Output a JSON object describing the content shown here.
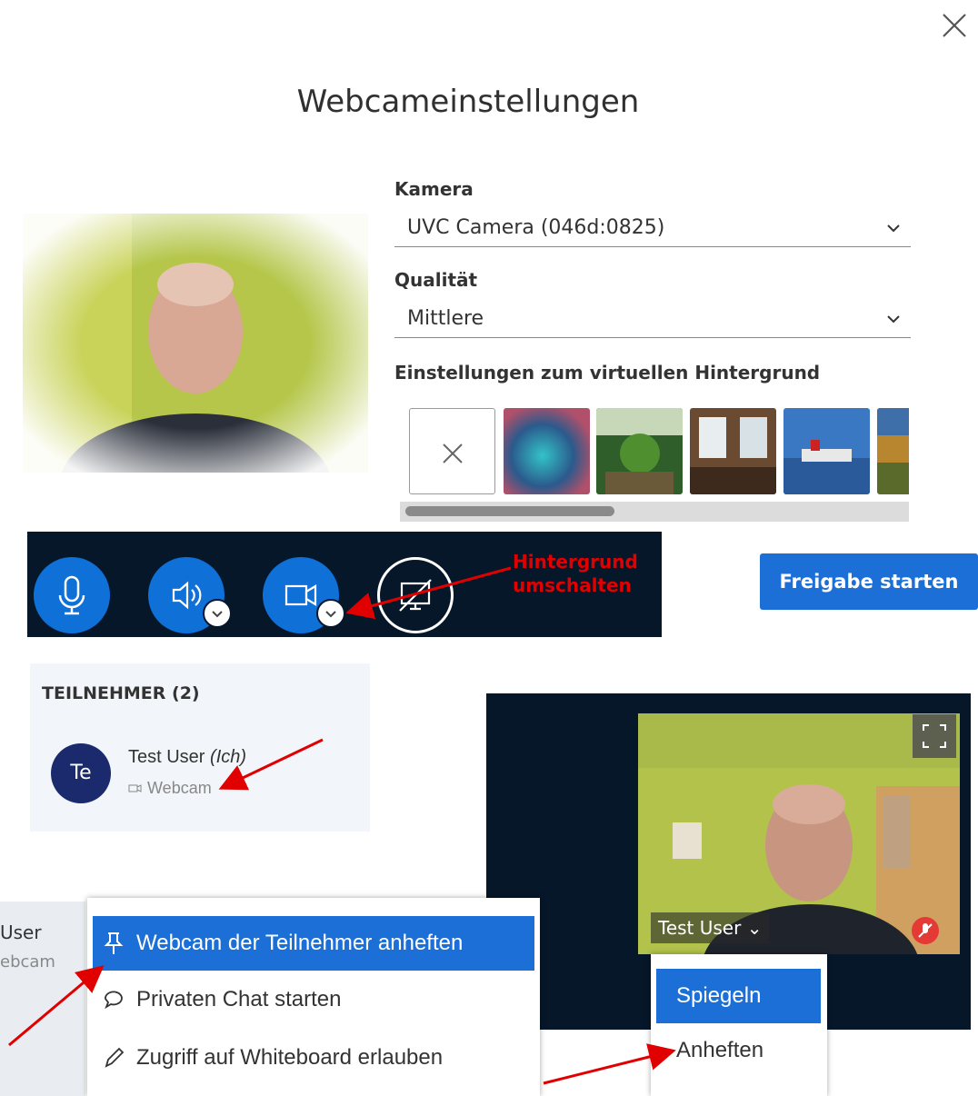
{
  "modal": {
    "title": "Webcameinstellungen",
    "close_icon": "close-icon"
  },
  "settings": {
    "camera_label": "Kamera",
    "camera_value": "UVC Camera (046d:0825)",
    "quality_label": "Qualität",
    "quality_value": "Mittlere",
    "virtual_bg_label": "Einstellungen zum virtuellen Hintergrund",
    "backgrounds": [
      "none",
      "blur",
      "garden",
      "interior",
      "harbor",
      "partial"
    ]
  },
  "action_bar": {
    "buttons": [
      "microphone-icon",
      "speaker-icon",
      "webcam-icon",
      "screen-share-icon"
    ],
    "annotation_line1": "Hintergrund",
    "annotation_line2": "umschalten"
  },
  "share_button": "Freigabe starten",
  "users": {
    "heading": "TEILNEHMER (2)",
    "avatar": "Te",
    "name": "Test User",
    "you_suffix": "(Ich)",
    "status": "Webcam"
  },
  "video": {
    "name_tag": "Test User"
  },
  "context_menu": {
    "left_peek_line1": "User",
    "left_peek_line2": "ebcam",
    "items": [
      {
        "label": "Webcam der Teilnehmer anheften",
        "icon": "pin-icon"
      },
      {
        "label": "Privaten Chat starten",
        "icon": "chat-icon"
      },
      {
        "label": "Zugriff auf Whiteboard erlauben",
        "icon": "pencil-icon"
      }
    ]
  },
  "video_menu": {
    "items": [
      "Spiegeln",
      "Anheften"
    ]
  },
  "colors": {
    "accent": "#1b6fd6",
    "dark_bar": "#06172a",
    "annotation": "#e00000"
  }
}
